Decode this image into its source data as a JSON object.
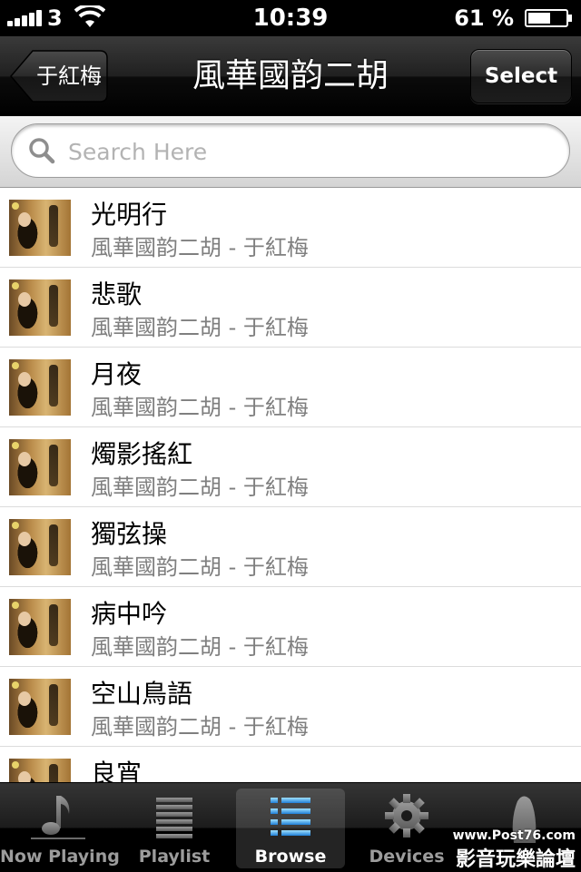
{
  "status_bar": {
    "carrier": "3",
    "time": "10:39",
    "battery_percent": "61 %",
    "battery_level": 0.61,
    "signal_bars": 5
  },
  "nav": {
    "back_label": "于紅梅",
    "title": "風華國韵二胡",
    "select_label": "Select"
  },
  "search": {
    "placeholder": "Search Here",
    "value": ""
  },
  "list": {
    "items": [
      {
        "title": "光明行",
        "subtitle": "風華國韵二胡 - 于紅梅"
      },
      {
        "title": "悲歌",
        "subtitle": "風華國韵二胡 - 于紅梅"
      },
      {
        "title": "月夜",
        "subtitle": "風華國韵二胡 - 于紅梅"
      },
      {
        "title": "燭影搖紅",
        "subtitle": "風華國韵二胡 - 于紅梅"
      },
      {
        "title": "獨弦操",
        "subtitle": "風華國韵二胡 - 于紅梅"
      },
      {
        "title": "病中吟",
        "subtitle": "風華國韵二胡 - 于紅梅"
      },
      {
        "title": "空山鳥語",
        "subtitle": "風華國韵二胡 - 于紅梅"
      },
      {
        "title": "良宵",
        "subtitle": ""
      }
    ]
  },
  "tabs": [
    {
      "label": "Now Playing",
      "icon": "music-note-icon",
      "active": false
    },
    {
      "label": "Playlist",
      "icon": "playlist-icon",
      "active": false
    },
    {
      "label": "Browse",
      "icon": "browse-list-icon",
      "active": true
    },
    {
      "label": "Devices",
      "icon": "gear-icon",
      "active": false
    },
    {
      "label": "",
      "icon": "more-icon",
      "active": false
    }
  ],
  "watermark": {
    "url": "www.Post76.com",
    "text": "影音玩樂論壇"
  },
  "colors": {
    "nav_background": "#1c1c1c",
    "active_tab": "#3aa0e8",
    "subtitle": "#7f7f7f"
  }
}
